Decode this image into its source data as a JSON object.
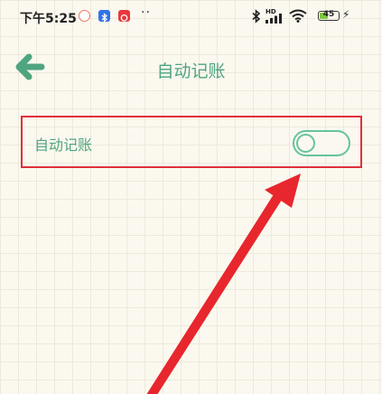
{
  "status_bar": {
    "time": "下午5:25",
    "dots": "··",
    "network": "HD",
    "battery": "45",
    "battery_level": 0.45,
    "bolt": "⚡"
  },
  "header": {
    "title": "自动记账",
    "back_icon": "arrow-left-icon"
  },
  "setting": {
    "label": "自动记账",
    "enabled": false
  },
  "colors": {
    "accent": "#4fa57f",
    "toggle": "#65c49c",
    "highlight": "#e0303a",
    "background": "#fbf8ef"
  }
}
